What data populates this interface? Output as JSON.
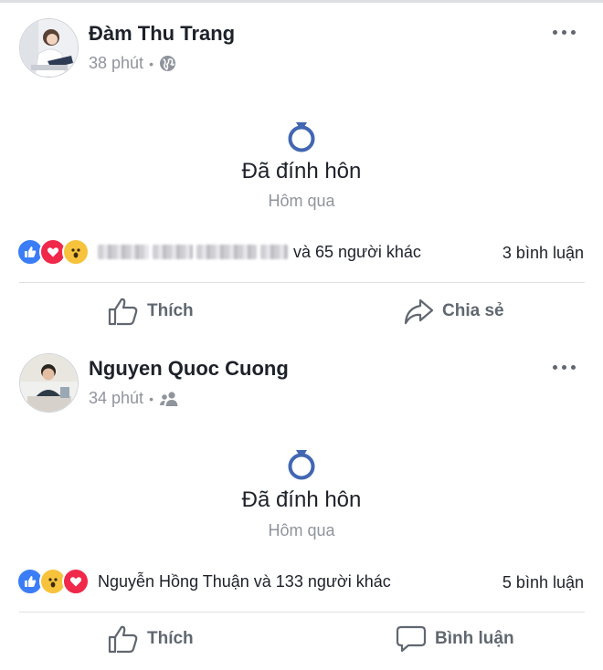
{
  "posts": [
    {
      "author": "Đàm Thu Trang",
      "time": "38 phút",
      "separator": "•",
      "privacy_icon": "globe-icon",
      "event_icon": "ring-icon",
      "event_title": "Đã đính hôn",
      "event_date": "Hôm qua",
      "reaction_icons": [
        "like-icon",
        "love-icon",
        "wow-icon"
      ],
      "reaction_text": "và 65 người khác",
      "comments": "3 bình luận",
      "actions": {
        "like": "Thích",
        "second": "Chia sẻ"
      }
    },
    {
      "author": "Nguyen Quoc Cuong",
      "time": "34 phút",
      "separator": "•",
      "privacy_icon": "friends-icon",
      "event_icon": "ring-icon",
      "event_title": "Đã đính hôn",
      "event_date": "Hôm qua",
      "reaction_icons": [
        "like-icon",
        "wow-icon",
        "love-icon"
      ],
      "reaction_text": "Nguyễn Hồng Thuận và 133 người khác",
      "comments": "5 bình luận",
      "actions": {
        "like": "Thích",
        "second": "Bình luận"
      }
    }
  ],
  "colors": {
    "like_blue": "#3b7df6",
    "love_red": "#f0284a",
    "wow_yellow": "#f7c33c",
    "ring_blue": "#4267b2"
  }
}
